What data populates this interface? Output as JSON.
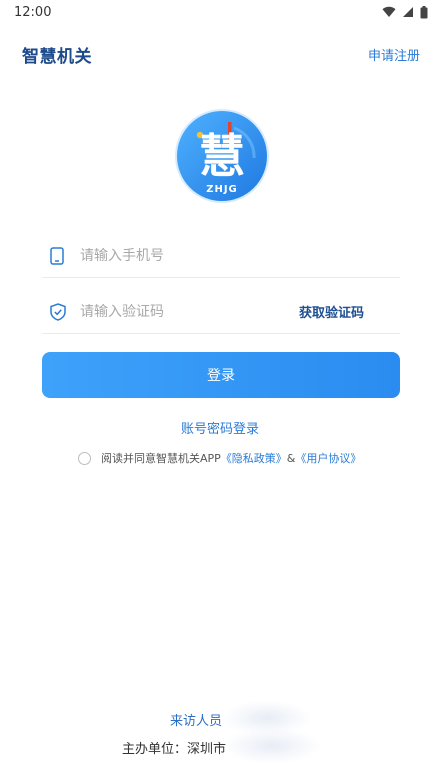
{
  "status_bar": {
    "time": "12:00"
  },
  "header": {
    "title": "智慧机关",
    "register_label": "申请注册"
  },
  "logo": {
    "char": "慧",
    "caption": "ZHJG"
  },
  "form": {
    "phone_placeholder": "请输入手机号",
    "code_placeholder": "请输入验证码",
    "get_code_label": "获取验证码",
    "login_label": "登录",
    "password_login_label": "账号密码登录"
  },
  "agreement": {
    "prefix": "阅读并同意智慧机关APP",
    "privacy": "《隐私政策》",
    "and": "&",
    "user": "《用户协议》"
  },
  "footer": {
    "visitor_label": "来访人员",
    "org_label": "主办单位：深圳市"
  },
  "colors": {
    "accent": "#2a8cf0",
    "title": "#1d4a8a",
    "link": "#2a7bd6"
  }
}
